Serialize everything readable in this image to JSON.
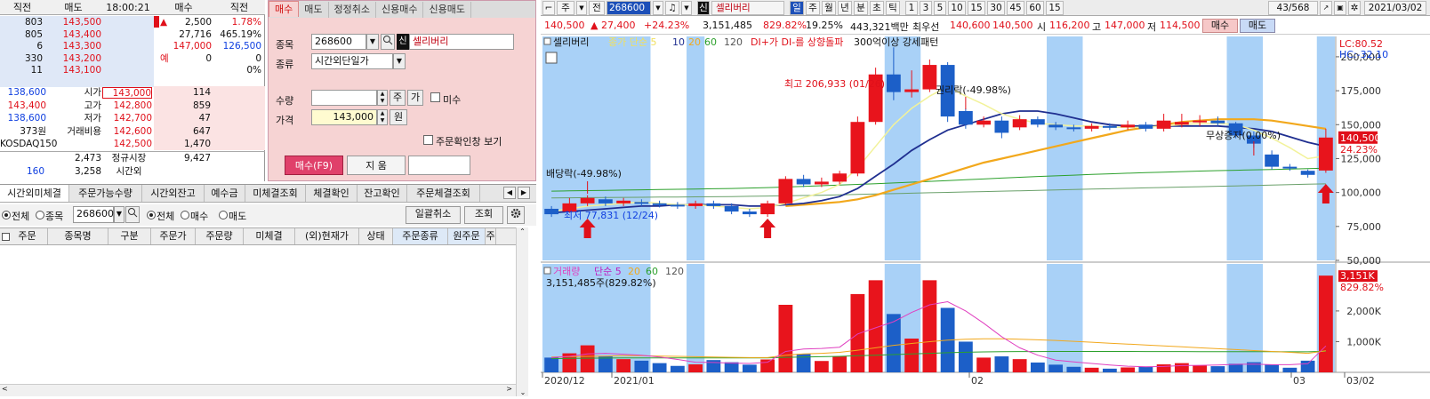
{
  "orderbook": {
    "headers": [
      "직전",
      "매도",
      "18:00:21",
      "매수",
      "직전"
    ],
    "ask_rows": [
      {
        "prev": "803",
        "price": "143,500",
        "extra_sign": "▲",
        "extra1": "2,500",
        "extra2": "1.78%"
      },
      {
        "prev": "805",
        "price": "143,400",
        "extra_sign": "",
        "extra1": "27,716",
        "extra2": "465.19%"
      },
      {
        "prev": "6",
        "price": "143,300",
        "extra_sign": "",
        "extra1": "147,000",
        "extra2": "126,500"
      },
      {
        "prev": "330",
        "price": "143,200",
        "extra_sign": "예",
        "extra1": "0",
        "extra2": "0"
      },
      {
        "prev": "11",
        "price": "143,100",
        "extra_sign": "",
        "extra1": "",
        "extra2": "0%"
      }
    ],
    "bid_rows": [
      {
        "left": "138,600",
        "label": "시가",
        "price": "143,000",
        "qty": "114"
      },
      {
        "left": "143,400",
        "label": "고가",
        "price": "142,800",
        "qty": "859"
      },
      {
        "left": "138,600",
        "label": "저가",
        "price": "142,700",
        "qty": "47"
      },
      {
        "left": "373원",
        "label": "거래비용",
        "price": "142,600",
        "qty": "647"
      },
      {
        "left": "KOSDAQ150",
        "label": "",
        "price": "142,500",
        "qty": "1,470"
      }
    ],
    "footer1": {
      "a": "2,473",
      "b": "정규시장",
      "c": "9,427"
    },
    "footer2": {
      "a": "160",
      "b": "3,258",
      "c": "시간외"
    }
  },
  "order_form": {
    "tabs": [
      "매수",
      "매도",
      "정정취소",
      "신용매수",
      "신용매도"
    ],
    "code_label": "종목",
    "code_value": "268600",
    "new_badge": "신",
    "stock_name": "셀리버리",
    "type_label": "종류",
    "type_value": "시간외단일가",
    "qty_label": "수량",
    "qty_value": "",
    "qty_btn1": "주",
    "qty_btn2": "가",
    "margin_label": "미수",
    "price_label": "가격",
    "price_value": "143,000",
    "price_unit": "원",
    "confirm_label": "주문확인창 보기",
    "buy_button": "매수(F9)",
    "clear_button": "지 움"
  },
  "bottom": {
    "tabs": [
      "시간외미체결",
      "주문가능수량",
      "시간외잔고",
      "예수금",
      "미체결조회",
      "체결확인",
      "잔고확인",
      "주문체결조회"
    ],
    "filter1_all": "전체",
    "filter1_code": "종목",
    "code_value": "268600",
    "filter2_all": "전체",
    "filter2_buy": "매수",
    "filter2_sell": "매도",
    "cancel_all": "일괄취소",
    "query": "조회",
    "columns": [
      "주문",
      "종목명",
      "구분",
      "주문가",
      "주문량",
      "미체결",
      "(외)현재가",
      "상태",
      "주문종류",
      "원주문",
      "주"
    ]
  },
  "chart_toolbar": {
    "mode": "주",
    "prev": "전",
    "code": "268600",
    "badge": "신",
    "name": "셀리버리",
    "periods": [
      "일",
      "주",
      "월",
      "년",
      "분",
      "초",
      "틱"
    ],
    "intervals": [
      "1",
      "3",
      "5",
      "10",
      "15",
      "30",
      "45",
      "60",
      "15"
    ],
    "count": "43/568",
    "date": "2021/03/02"
  },
  "price_info": {
    "price": "140,500",
    "change": "▲ 27,400",
    "pct": "+24.23%",
    "volume": "3,151,485",
    "vol_pct": "829.82%",
    "turnover": "19.25%",
    "amount": "443,321백만",
    "pri_label": "최우선",
    "pri1": "140,600",
    "pri2": "140,500",
    "open_label": "시",
    "open": "116,200",
    "high_label": "고",
    "high": "147,000",
    "low_label": "저",
    "low": "114,500",
    "buy": "매수",
    "sell": "매도"
  },
  "chart_legend": {
    "name": "셀리버리",
    "ma_label": "종가 단순",
    "ma": [
      "5",
      "10",
      "20",
      "60",
      "120"
    ],
    "indicator": "DI+가 DI-를 상향돌파",
    "pattern": "300억이상 강세패턴",
    "lc": "LC:80.52",
    "hc": "HC:-32.10",
    "last_price": "140,500",
    "last_pct": "24.23%"
  },
  "annotations": {
    "high": "최고 206,933 (01/26)",
    "low": "최저 77,831 (12/24)",
    "rights": "권리락(-49.98%)",
    "dividend": "배당락(-49.98%)",
    "bonus": "무상증자(0.00%)"
  },
  "volume_legend": {
    "label": "거래량",
    "ma_label": "단순",
    "ma": [
      "5",
      "20",
      "60",
      "120"
    ],
    "value": "3,151,485주(829.82%)",
    "last": "3,151K",
    "last_pct": "829.82%"
  },
  "x_labels": [
    "2020/12",
    "2021/01",
    "02",
    "03",
    "03/02"
  ],
  "colors": {
    "up": "#e8141c",
    "down": "#1c5fc8",
    "highlight": "#a9d1f7",
    "ma5": "#f2f29a",
    "ma10": "#1f2f90",
    "ma20": "#f2a81c",
    "ma60": "#2ca02c"
  },
  "chart_data": {
    "type": "candlestick",
    "ylim": [
      50000,
      215000
    ],
    "y_ticks": [
      200000,
      175000,
      150000,
      125000,
      100000,
      75000,
      50000
    ],
    "y_tick_labels": [
      "200,000",
      "175,000",
      "150,000",
      "125,000",
      "100,000",
      "75,000",
      "50,000"
    ],
    "vol_ylim": [
      0,
      3300
    ],
    "vol_ticks": [
      2000,
      1000
    ],
    "vol_tick_labels": [
      "2,000K",
      "1,000K"
    ],
    "candles": [
      {
        "o": 88000,
        "c": 84000,
        "h": 90000,
        "l": 82000,
        "v": 480
      },
      {
        "o": 86000,
        "c": 92000,
        "h": 96000,
        "l": 85000,
        "v": 620
      },
      {
        "o": 92000,
        "c": 96000,
        "h": 98000,
        "l": 90000,
        "v": 880
      },
      {
        "o": 95000,
        "c": 92000,
        "h": 97000,
        "l": 90000,
        "v": 520
      },
      {
        "o": 92000,
        "c": 94000,
        "h": 96000,
        "l": 90000,
        "v": 430
      },
      {
        "o": 93000,
        "c": 92000,
        "h": 95000,
        "l": 90000,
        "v": 380
      },
      {
        "o": 92000,
        "c": 91000,
        "h": 94000,
        "l": 89000,
        "v": 300
      },
      {
        "o": 91000,
        "c": 90000,
        "h": 93000,
        "l": 88000,
        "v": 210
      },
      {
        "o": 90000,
        "c": 92000,
        "h": 94000,
        "l": 88000,
        "v": 260
      },
      {
        "o": 92000,
        "c": 90000,
        "h": 94000,
        "l": 88000,
        "v": 400
      },
      {
        "o": 90000,
        "c": 86000,
        "h": 92000,
        "l": 84000,
        "v": 330
      },
      {
        "o": 86000,
        "c": 84000,
        "h": 88000,
        "l": 82000,
        "v": 250
      },
      {
        "o": 84000,
        "c": 92000,
        "h": 94000,
        "l": 82000,
        "v": 420
      },
      {
        "o": 92000,
        "c": 110000,
        "h": 112000,
        "l": 91000,
        "v": 2200
      },
      {
        "o": 110000,
        "c": 106000,
        "h": 113000,
        "l": 104000,
        "v": 600
      },
      {
        "o": 106000,
        "c": 108000,
        "h": 111000,
        "l": 104000,
        "v": 370
      },
      {
        "o": 108000,
        "c": 114000,
        "h": 116000,
        "l": 106000,
        "v": 520
      },
      {
        "o": 114000,
        "c": 152000,
        "h": 156000,
        "l": 112000,
        "v": 2550
      },
      {
        "o": 152000,
        "c": 187000,
        "h": 192000,
        "l": 150000,
        "v": 3000
      },
      {
        "o": 187000,
        "c": 174000,
        "h": 206933,
        "l": 168000,
        "v": 1900
      },
      {
        "o": 174000,
        "c": 176000,
        "h": 190000,
        "l": 170000,
        "v": 1100
      },
      {
        "o": 176000,
        "c": 194000,
        "h": 198000,
        "l": 174000,
        "v": 3000
      },
      {
        "o": 194000,
        "c": 156000,
        "h": 196000,
        "l": 152000,
        "v": 2100
      },
      {
        "o": 160000,
        "c": 150000,
        "h": 162000,
        "l": 147000,
        "v": 1000
      },
      {
        "o": 150000,
        "c": 153000,
        "h": 156000,
        "l": 148000,
        "v": 480
      },
      {
        "o": 153000,
        "c": 144000,
        "h": 156000,
        "l": 140000,
        "v": 520
      },
      {
        "o": 148000,
        "c": 154000,
        "h": 157000,
        "l": 146000,
        "v": 430
      },
      {
        "o": 154000,
        "c": 150000,
        "h": 156000,
        "l": 148000,
        "v": 320
      },
      {
        "o": 150000,
        "c": 148000,
        "h": 152000,
        "l": 146000,
        "v": 250
      },
      {
        "o": 148000,
        "c": 147000,
        "h": 150000,
        "l": 145000,
        "v": 180
      },
      {
        "o": 147000,
        "c": 149000,
        "h": 151000,
        "l": 145000,
        "v": 150
      },
      {
        "o": 149000,
        "c": 148000,
        "h": 151000,
        "l": 146000,
        "v": 120
      },
      {
        "o": 148000,
        "c": 150000,
        "h": 153000,
        "l": 146000,
        "v": 160
      },
      {
        "o": 150000,
        "c": 147000,
        "h": 152000,
        "l": 145000,
        "v": 190
      },
      {
        "o": 147000,
        "c": 153000,
        "h": 158000,
        "l": 145000,
        "v": 260
      },
      {
        "o": 150000,
        "c": 152000,
        "h": 158000,
        "l": 148000,
        "v": 300
      },
      {
        "o": 152000,
        "c": 153000,
        "h": 157000,
        "l": 149000,
        "v": 220
      },
      {
        "o": 153000,
        "c": 151000,
        "h": 156000,
        "l": 149000,
        "v": 200
      },
      {
        "o": 151000,
        "c": 142000,
        "h": 152000,
        "l": 140000,
        "v": 280
      },
      {
        "o": 142000,
        "c": 136000,
        "h": 145000,
        "l": 133000,
        "v": 330
      },
      {
        "o": 128000,
        "c": 119000,
        "h": 131000,
        "l": 117000,
        "v": 260
      },
      {
        "o": 119000,
        "c": 118000,
        "h": 121000,
        "l": 116000,
        "v": 150
      },
      {
        "o": 116000,
        "c": 113000,
        "h": 117000,
        "l": 111000,
        "v": 380
      },
      {
        "o": 116200,
        "c": 140500,
        "h": 147000,
        "l": 114500,
        "v": 3151
      }
    ],
    "ma5": [
      86000,
      88000,
      90000,
      91000,
      92000,
      93000,
      92000,
      91000,
      91000,
      90000,
      89000,
      88000,
      89000,
      92000,
      96000,
      100000,
      106000,
      118000,
      134000,
      150000,
      162000,
      171000,
      178000,
      171000,
      165000,
      158000,
      154000,
      151000,
      150000,
      149000,
      149000,
      148000,
      148000,
      148000,
      149000,
      150000,
      151000,
      151000,
      150000,
      146000,
      140000,
      133000,
      125000,
      127000
    ],
    "ma10": [
      85000,
      86000,
      87000,
      88000,
      89000,
      90000,
      90000,
      91000,
      91000,
      91000,
      91000,
      90000,
      90000,
      91000,
      92000,
      94000,
      97000,
      103000,
      112000,
      121000,
      131000,
      139000,
      146000,
      150000,
      154000,
      158000,
      160000,
      160000,
      158000,
      155000,
      152000,
      150000,
      149000,
      149000,
      149000,
      149000,
      149000,
      149000,
      148000,
      147000,
      145000,
      141000,
      137000,
      134000
    ],
    "ma20": [
      null,
      null,
      null,
      null,
      null,
      null,
      null,
      null,
      null,
      null,
      null,
      null,
      null,
      90000,
      91000,
      92000,
      93000,
      95000,
      98000,
      102000,
      106000,
      110000,
      114000,
      118000,
      122000,
      125000,
      128000,
      131000,
      134000,
      137000,
      140000,
      143000,
      146000,
      148000,
      150000,
      152000,
      153000,
      154000,
      154000,
      154000,
      153000,
      151000,
      149000,
      147000
    ],
    "ma60": [
      101000,
      101200,
      101400,
      101600,
      101800,
      102000,
      102200,
      102400,
      102600,
      102800,
      103000,
      103300,
      103600,
      104000,
      104500,
      105000,
      105500,
      106000,
      106500,
      107000,
      107600,
      108200,
      108800,
      109400,
      110000,
      110600,
      111200,
      111800,
      112300,
      112800,
      113300,
      113800,
      114200,
      114600,
      115000,
      115400,
      115800,
      116100,
      116400,
      116700,
      117000,
      117300,
      117600,
      117900
    ],
    "ma120": [
      96000,
      96100,
      96200,
      96300,
      96400,
      96500,
      96600,
      96700,
      96800,
      96900,
      97000,
      97200,
      97400,
      97600,
      97800,
      98000,
      98300,
      98600,
      98900,
      99200,
      99500,
      99800,
      100100,
      100400,
      100700,
      101000,
      101300,
      101600,
      101900,
      102200,
      102500,
      102800,
      103100,
      103400,
      103700,
      104000,
      104300,
      104600,
      104900,
      105200,
      105500,
      105800,
      106100,
      106400
    ],
    "vol_ma5": [
      480,
      520,
      600,
      620,
      590,
      560,
      500,
      420,
      330,
      320,
      300,
      290,
      330,
      680,
      760,
      780,
      820,
      1250,
      1450,
      1650,
      1950,
      2200,
      2300,
      2000,
      1600,
      1160,
      800,
      560,
      400,
      340,
      290,
      240,
      200,
      180,
      190,
      220,
      230,
      240,
      260,
      270,
      250,
      250,
      280,
      860
    ],
    "vol_ma20": [
      500,
      510,
      520,
      530,
      540,
      540,
      530,
      520,
      510,
      500,
      490,
      480,
      480,
      560,
      600,
      620,
      650,
      720,
      800,
      880,
      940,
      1000,
      1050,
      1080,
      1090,
      1090,
      1080,
      1060,
      1040,
      1010,
      980,
      950,
      920,
      890,
      860,
      830,
      800,
      770,
      740,
      710,
      680,
      650,
      620,
      700
    ],
    "vol_ma60": [
      450,
      455,
      460,
      465,
      470,
      470,
      470,
      470,
      470,
      470,
      470,
      470,
      470,
      490,
      500,
      510,
      520,
      540,
      560,
      580,
      600,
      620,
      640,
      655,
      665,
      672,
      676,
      678,
      679,
      680,
      680,
      680,
      679,
      678,
      677,
      676,
      675,
      674,
      673,
      672,
      671,
      670,
      669,
      690
    ],
    "highlight_bars": [
      [
        8,
        9
      ],
      [
        19,
        20
      ],
      [
        28,
        29
      ],
      [
        38,
        39
      ]
    ]
  }
}
